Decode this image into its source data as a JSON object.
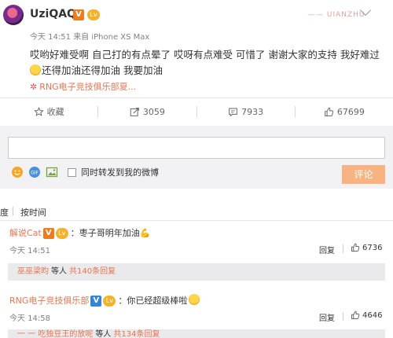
{
  "post": {
    "username": "UziQAQ",
    "v_badge": "V",
    "level_badge": "Lv",
    "watermark": "—— UIANZHU",
    "time": "今天 14:51",
    "source": "来自 iPhone XS Max",
    "text_line1": "哎哟好难受啊 自己打的有点晕了 哎呀有点难受 可惜了 谢谢大家的支持 我好难过",
    "text_line2": "还得加油还得加油 我要加油",
    "tag": "RNG电子竞技俱乐部夏..."
  },
  "actions": {
    "collect": "收藏",
    "repost": "3059",
    "comment": "7933",
    "like": "67699"
  },
  "composer": {
    "placeholder": "",
    "repost_label": "同时转发到我的微博",
    "submit": "评论"
  },
  "sort": {
    "hot": "度",
    "by_time": "按时间"
  },
  "comments": [
    {
      "user": "解说Cat",
      "text": "：枣子哥明年加油💪",
      "time": "今天 14:51",
      "reply": "回复",
      "likes": "6736",
      "sub_user": "巫巫梁昀",
      "sub_mid": "等人",
      "sub_count": "共140条回复"
    },
    {
      "user": "RNG电子竞技俱乐部",
      "text": "：你已经超级棒啦",
      "time": "今天 14:58",
      "reply": "回复",
      "likes": "4646",
      "sub_user": "一 一 吃独豆王的放呢",
      "sub_mid": "等人",
      "sub_count": "共134条回复"
    }
  ],
  "colors": {
    "accent": "#eb7350",
    "button": "#f7b381",
    "badge": "#f07b1d"
  }
}
